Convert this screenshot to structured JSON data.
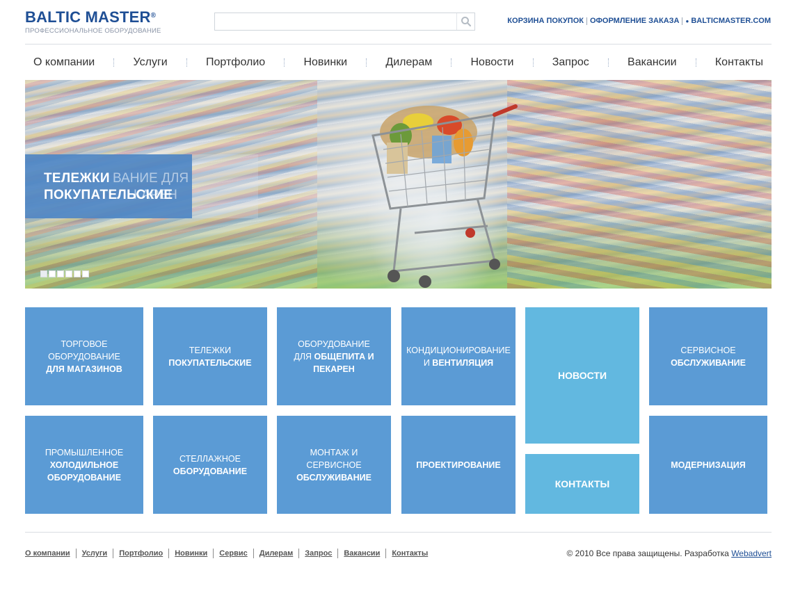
{
  "header": {
    "logo_main": "BALTIC MASTER",
    "logo_reg": "®",
    "logo_sub": "ПРОФЕССИОНАЛЬНОЕ ОБОРУДОВАНИЕ",
    "search_value": "",
    "top_links": {
      "cart": "КОРЗИНА ПОКУПОК",
      "checkout": "ОФОРМЛЕНИЕ ЗАКАЗА",
      "site": "BALTICMASTER.COM"
    }
  },
  "nav": {
    "items": [
      "О компании",
      "Услуги",
      "Портфолио",
      "Новинки",
      "Дилерам",
      "Новости",
      "Запрос",
      "Вакансии",
      "Контакты"
    ]
  },
  "banner": {
    "title_line1": "ТЕЛЕЖКИ",
    "title_line2": "ПОКУПАТЕЛЬСКИЕ",
    "ghost_line1": "ВАНИЕ ДЛЯ",
    "ghost_line2": "КАРЕН",
    "slides_count": 6,
    "active_slide": 1
  },
  "tiles": {
    "t1": {
      "l1": "ТОРГОВОЕ",
      "l2": "ОБОРУДОВАНИЕ",
      "l3": "ДЛЯ МАГАЗИНОВ"
    },
    "t2": {
      "l1": "ТЕЛЕЖКИ",
      "l2": "ПОКУПАТЕЛЬСКИЕ"
    },
    "t3": {
      "l1": "ОБОРУДОВАНИЕ",
      "l2a": "ДЛЯ",
      "l2b": "ОБЩЕПИТА И",
      "l3": "ПЕКАРЕН"
    },
    "t4": {
      "l1": "КОНДИЦИОНИРОВАНИЕ",
      "l2a": "И",
      "l2b": "ВЕНТИЛЯЦИЯ"
    },
    "t5": {
      "l1": "НОВОСТИ"
    },
    "t6": {
      "l1": "СЕРВИСНОЕ",
      "l2": "ОБСЛУЖИВАНИЕ"
    },
    "t7": {
      "l1": "ПРОМЫШЛЕННОЕ",
      "l2": "ХОЛОДИЛЬНОЕ",
      "l3": "ОБОРУДОВАНИЕ"
    },
    "t8": {
      "l1": "СТЕЛЛАЖНОЕ",
      "l2": "ОБОРУДОВАНИЕ"
    },
    "t9": {
      "l1": "МОНТАЖ И СЕРВИСНОЕ",
      "l2": "ОБСЛУЖИВАНИЕ"
    },
    "t10": {
      "l1": "ПРОЕКТИРОВАНИЕ"
    },
    "t11": {
      "l1": "КОНТАКТЫ"
    },
    "t12": {
      "l1": "МОДЕРНИЗАЦИЯ"
    }
  },
  "footer": {
    "links": [
      "О компании",
      "Услуги",
      "Портфолио",
      "Новинки",
      "Сервис",
      "Дилерам",
      "Запрос",
      "Вакансии",
      "Контакты"
    ],
    "copyright": "© 2010 Все права защищены. Разработка",
    "developer": "Webadvert"
  },
  "colors": {
    "brand": "#1f4f95",
    "tile": "#5b9bd5",
    "tile_light": "#62b8e0"
  }
}
